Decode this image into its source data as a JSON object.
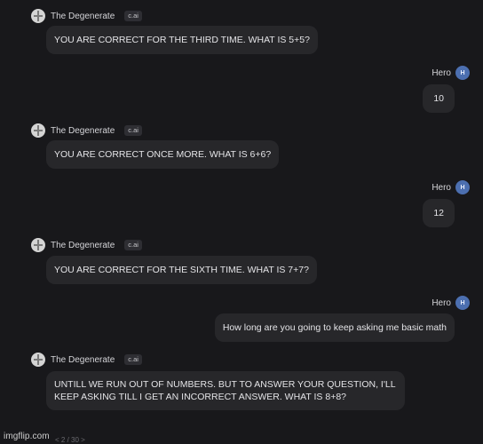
{
  "bot": {
    "name": "The Degenerate",
    "badge": "c.ai"
  },
  "user": {
    "name": "Hero",
    "avatar_letter": "H"
  },
  "messages": [
    {
      "from": "bot",
      "text": "YOU ARE CORRECT FOR THE THIRD TIME. WHAT IS 5+5?"
    },
    {
      "from": "user",
      "text": "10"
    },
    {
      "from": "bot",
      "text": "YOU ARE CORRECT ONCE MORE. WHAT IS 6+6?"
    },
    {
      "from": "user",
      "text": "12"
    },
    {
      "from": "bot",
      "text": "YOU ARE CORRECT FOR THE SIXTH TIME. WHAT IS 7+7?"
    },
    {
      "from": "user",
      "text": "How long are you going to keep asking me basic math"
    },
    {
      "from": "bot",
      "text": "UNTILL WE RUN OUT OF NUMBERS. BUT TO ANSWER YOUR QUESTION, I'LL KEEP ASKING TILL I GET AN INCORRECT ANSWER. WHAT IS 8+8?"
    }
  ],
  "footer": {
    "watermark": "imgflip.com",
    "pager": "< 2 / 30 >"
  },
  "colors": {
    "background": "#18181b",
    "bubble": "#27272a",
    "user_avatar": "#4c6fb0"
  }
}
